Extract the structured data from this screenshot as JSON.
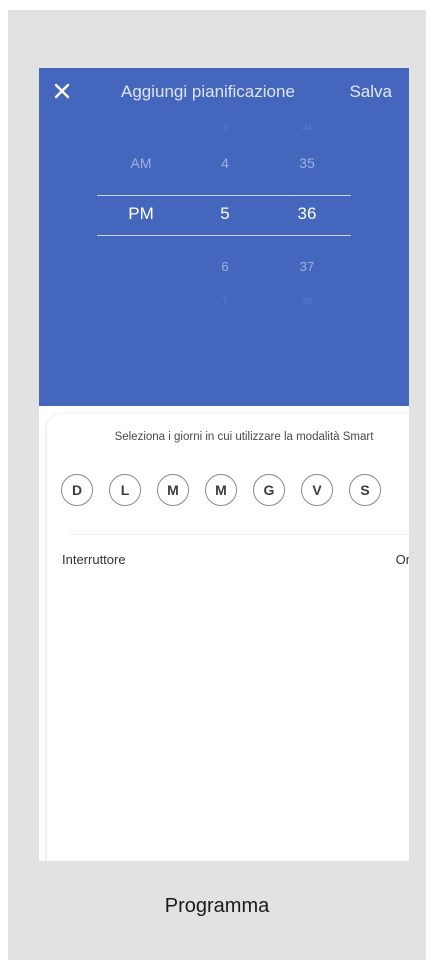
{
  "header": {
    "close_icon": "close-icon",
    "title": "Aggiungi pianificazione",
    "save_label": "Salva"
  },
  "picker": {
    "ampm": {
      "above": "AM",
      "selected": "PM"
    },
    "hour": {
      "above": "4",
      "selected": "5",
      "below": "6"
    },
    "minute": {
      "above": "35",
      "selected": "36",
      "below": "37"
    }
  },
  "sheet": {
    "prompt": "Seleziona i giorni in cui utilizzare la modalità Smart",
    "days": [
      "D",
      "L",
      "M",
      "M",
      "G",
      "V",
      "S"
    ],
    "row": {
      "label": "Interruttore",
      "value": "On",
      "chevron_icon": "chevron-right-icon"
    }
  },
  "caption": "Programma",
  "colors": {
    "header_bg": "#4467bd",
    "frame_bg": "#e2e2e2",
    "sheet_bg": "#ffffff"
  }
}
